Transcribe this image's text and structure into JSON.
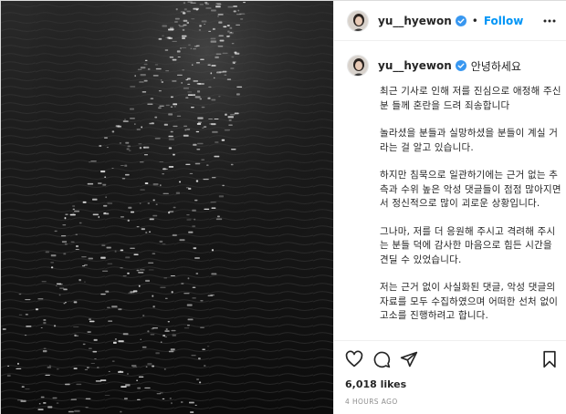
{
  "post": {
    "username": "yu__hyewon",
    "follow_label": "Follow",
    "separator": "•",
    "greeting": "안녕하세요",
    "paragraphs": [
      "최근 기사로 인해 저를 진심으로 애정해 주신 분 들께 혼란을 드려 죄송합니다",
      "놀라셨을 분들과 실망하셨을 분들이 계실 거라는 걸 알고 있습니다.",
      "하지만 침묵으로 일관하기에는 근거 없는 추측과 수위 높은 악성 댓글들이 점점 많아지면서 정신적으로 많이 괴로운 상황입니다.",
      "그나마, 저를 더 응원해 주시고 격려해 주시는 분들 덕에 감사한 마음으로 힘든 시간을 견딜 수 있었습니다.",
      "저는 근거 없이 사실화된 댓글, 악성 댓글의 자료를 모두 수집하였으며 어떠한 선처 없이 고소를 진행하려고 합니다."
    ],
    "likes": "6,018 likes",
    "timestamp": "4 HOURS AGO"
  },
  "icons": {
    "verified": "verified-badge-icon",
    "more": "more-options-icon",
    "like": "heart-icon",
    "comment": "comment-icon",
    "share": "share-icon",
    "save": "bookmark-icon"
  },
  "colors": {
    "accent": "#0095f6",
    "text": "#262626",
    "muted": "#8e8e8e",
    "water": "#141414"
  }
}
